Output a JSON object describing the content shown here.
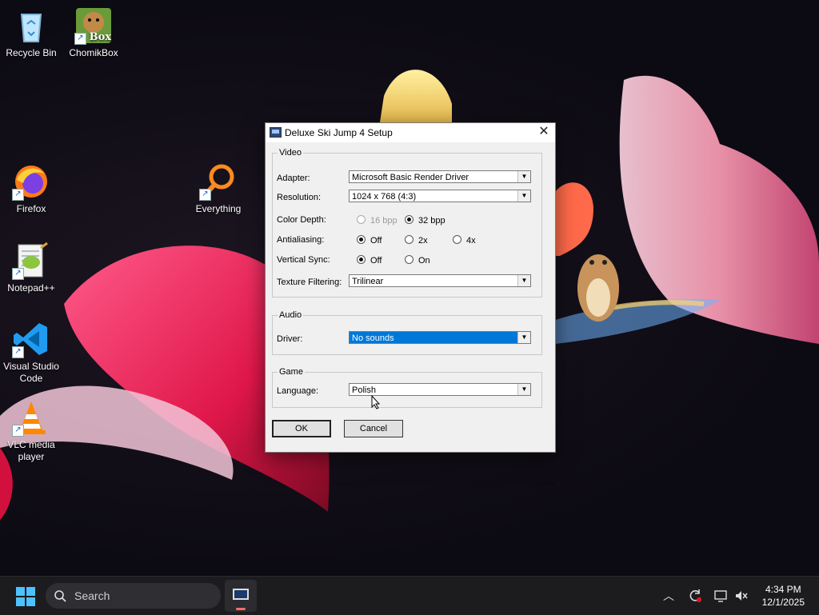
{
  "desktop": {
    "icons": [
      {
        "label": "Recycle Bin"
      },
      {
        "label": "ChomikBox",
        "badge": "Box"
      },
      {
        "label": "Firefox"
      },
      {
        "label": "Everything"
      },
      {
        "label": "Notepad++"
      },
      {
        "label": "Visual Studio Code"
      },
      {
        "label": "VLC media player"
      }
    ]
  },
  "dialog": {
    "title": "Deluxe Ski Jump 4 Setup",
    "close_glyph": "✕",
    "video": {
      "legend": "Video",
      "adapter_label": "Adapter:",
      "adapter_value": "Microsoft Basic Render Driver",
      "resolution_label": "Resolution:",
      "resolution_value": "1024 x 768 (4:3)",
      "color_depth_label": "Color Depth:",
      "color_depth_options": [
        "16 bpp",
        "32 bpp"
      ],
      "antialiasing_label": "Antialiasing:",
      "antialiasing_options": [
        "Off",
        "2x",
        "4x"
      ],
      "vsync_label": "Vertical Sync:",
      "vsync_options": [
        "Off",
        "On"
      ],
      "texture_label": "Texture Filtering:",
      "texture_value": "Trilinear"
    },
    "audio": {
      "legend": "Audio",
      "driver_label": "Driver:",
      "driver_value": "No sounds"
    },
    "game": {
      "legend": "Game",
      "language_label": "Language:",
      "language_value": "Polish"
    },
    "ok_label": "OK",
    "cancel_label": "Cancel"
  },
  "taskbar": {
    "search_label": "Search",
    "time": "4:34 PM",
    "date": "12/1/2025",
    "accent": "#4cc2ff"
  }
}
